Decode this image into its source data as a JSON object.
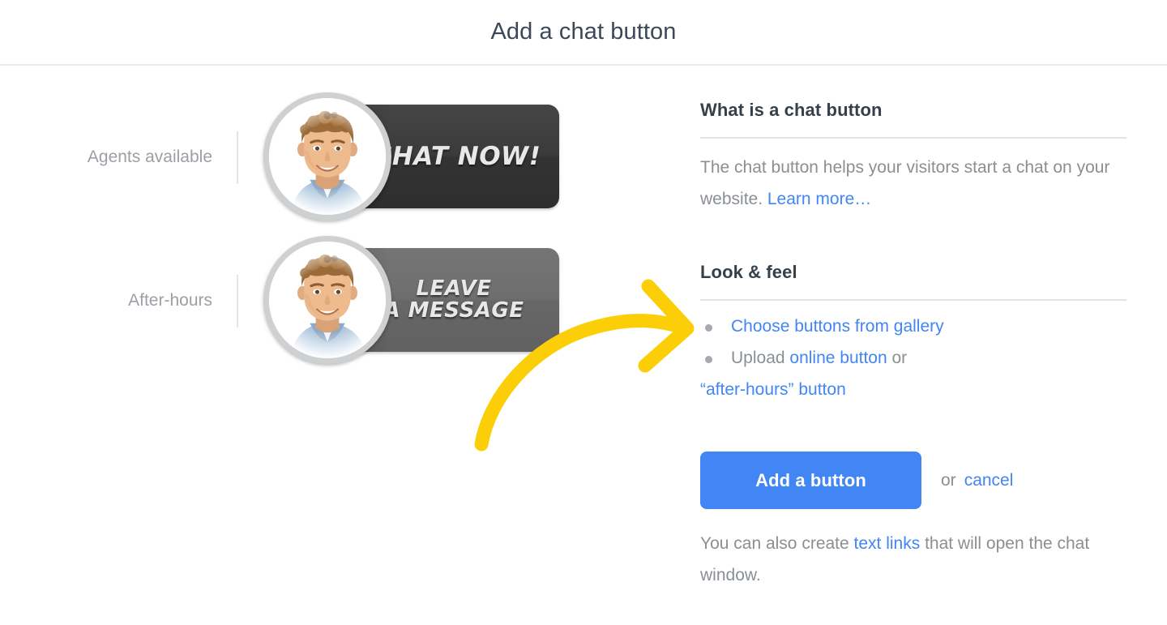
{
  "header": {
    "title": "Add a chat button"
  },
  "preview": {
    "rows": [
      {
        "label": "Agents available",
        "button_text": "CHAT NOW!",
        "button_style": "dark",
        "avatar": "agent-photo"
      },
      {
        "label": "After-hours",
        "button_text_line1": "LEAVE",
        "button_text_line2": "A MESSAGE",
        "button_style": "mid",
        "avatar": "agent-photo"
      }
    ]
  },
  "annotation": {
    "arrow": "curved-arrow-icon",
    "color": "#FBCE08"
  },
  "info": {
    "what_is": {
      "title": "What is a chat button",
      "text_before": "The chat button helps your visitors start a chat on your website. ",
      "link": "Learn more…"
    },
    "look_feel": {
      "title": "Look & feel",
      "bullet1_link": "Choose buttons from gallery",
      "bullet2_prefix": "Upload ",
      "bullet2_link1": "online button",
      "bullet2_mid": " or",
      "bullet2_link2": "“after-hours” button"
    },
    "cta": {
      "primary": "Add a button",
      "or": "or",
      "cancel": "cancel"
    },
    "footer": {
      "text_before": "You can also create ",
      "link": "text links",
      "text_after": " that will open the chat window."
    }
  },
  "colors": {
    "link_blue": "#4285f4",
    "primary_blue": "#4285f4",
    "arrow_yellow": "#FBCE08",
    "title_slate": "#3c4858",
    "body_gray": "#8a8f94"
  }
}
